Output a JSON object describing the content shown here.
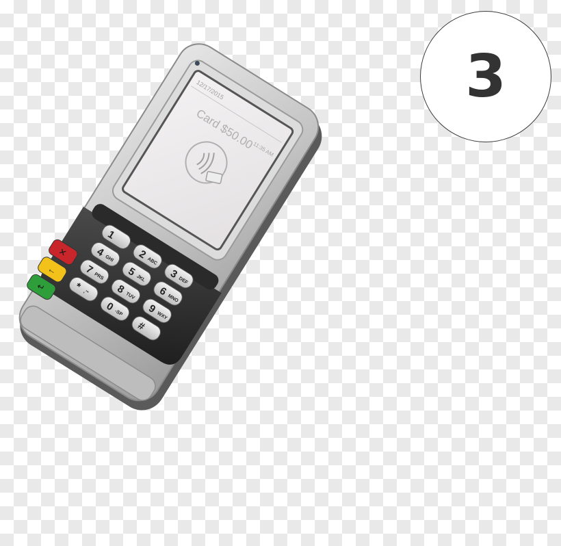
{
  "step": {
    "number": "3"
  },
  "terminal": {
    "screen_date": "12/17/2015",
    "screen_time": "11:35 AM",
    "screen_amount_text": "Card $50.00",
    "contactless_icon": "tap-card-contactless-icon",
    "keys": [
      {
        "digit": "1",
        "letters": ""
      },
      {
        "digit": "2",
        "letters": "ABC"
      },
      {
        "digit": "3",
        "letters": "DEF"
      },
      {
        "digit": "4",
        "letters": "GHI"
      },
      {
        "digit": "5",
        "letters": "JKL"
      },
      {
        "digit": "6",
        "letters": "MNO"
      },
      {
        "digit": "7",
        "letters": "PRS"
      },
      {
        "digit": "8",
        "letters": "TUV"
      },
      {
        "digit": "9",
        "letters": "WXY"
      },
      {
        "digit": "*",
        "letters": ",'\""
      },
      {
        "digit": "0",
        "letters": "-SP"
      },
      {
        "digit": "#",
        "letters": ""
      }
    ],
    "function_keys": {
      "cancel_icon": "x-icon",
      "clear_icon": "backspace-arrow-icon",
      "enter_icon": "enter-arrow-icon"
    },
    "colors": {
      "cancel": "#c9262c",
      "clear": "#f2c21a",
      "enter": "#2e9e3a",
      "body": "#c8c8c8",
      "keypad_shroud": "#2d2d2d"
    }
  }
}
